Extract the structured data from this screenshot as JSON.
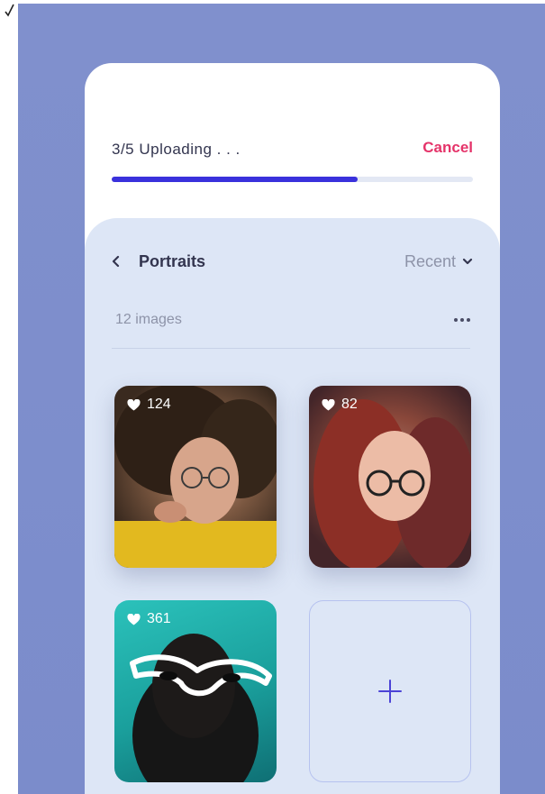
{
  "upload": {
    "status": "3/5 Uploading . . .",
    "cancel_label": "Cancel",
    "progress_fraction": 0.68
  },
  "album": {
    "title": "Portraits",
    "sort_label": "Recent",
    "count_label": "12 images"
  },
  "photos": [
    {
      "likes": "124",
      "description": "woman with curly hair and round glasses, yellow top"
    },
    {
      "likes": "82",
      "description": "woman with red-lit long hair and round glasses"
    },
    {
      "likes": "361",
      "description": "woman wearing white cat-eye sunglasses on teal background"
    }
  ],
  "icons": {
    "back": "chevron-left-icon",
    "sort": "chevron-down-icon",
    "more": "more-horizontal-icon",
    "like": "heart-icon",
    "add": "plus-icon"
  },
  "colors": {
    "backdrop": "#7b8ccb",
    "accent": "#3a31dc",
    "cancel": "#e5346a",
    "panel": "#dde6f6",
    "text_primary": "#33354f",
    "text_muted": "#8d93a8"
  }
}
